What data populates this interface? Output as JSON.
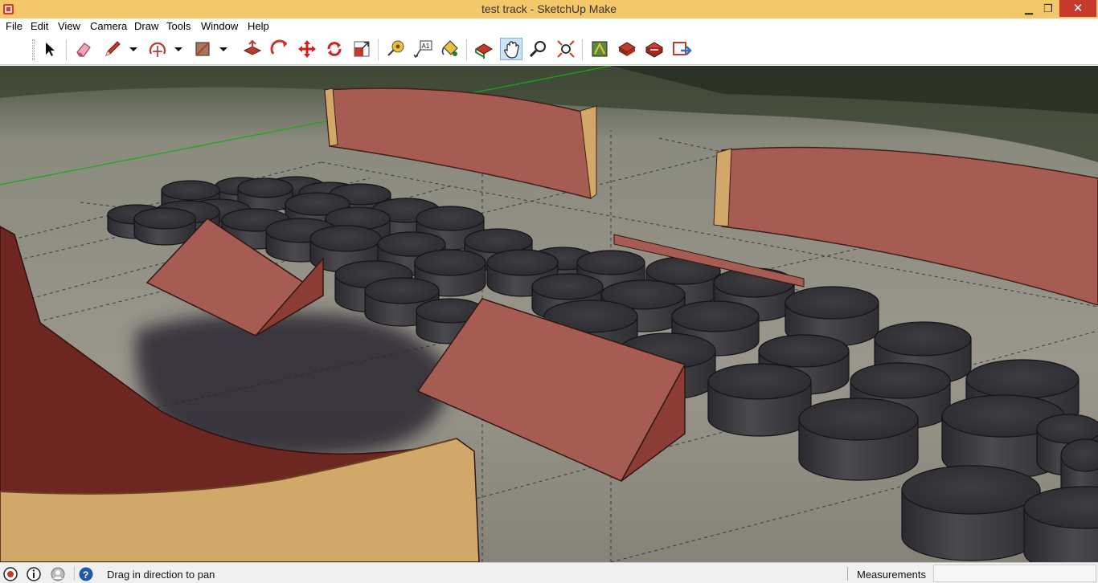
{
  "window": {
    "title": "test track - SketchUp Make",
    "minimize": "▁",
    "maximize": "❐",
    "close": "✕"
  },
  "menu": {
    "items": [
      "File",
      "Edit",
      "View",
      "Camera",
      "Draw",
      "Tools",
      "Window",
      "Help"
    ]
  },
  "toolbar": {
    "tools": [
      "select",
      "eraser",
      "pencil",
      "arc",
      "rectangle",
      "push-pull",
      "follow-me",
      "move",
      "rotate",
      "scale",
      "tape-measure",
      "text",
      "paint-bucket",
      "orbit",
      "pan",
      "zoom",
      "zoom-extents",
      "previous-view",
      "component",
      "styles",
      "get-models",
      "share-model"
    ],
    "active_tool": "pan"
  },
  "status": {
    "message": "Drag in direction to pan",
    "measurements_label": "Measurements",
    "measurements_value": ""
  },
  "colors": {
    "titlebar": "#f2c86a",
    "close_button": "#c7392d",
    "wall_face": "#a65c52",
    "wall_edge": "#d2a86a",
    "tire": "#3b3a3e",
    "ground": "#8a8a7c"
  }
}
